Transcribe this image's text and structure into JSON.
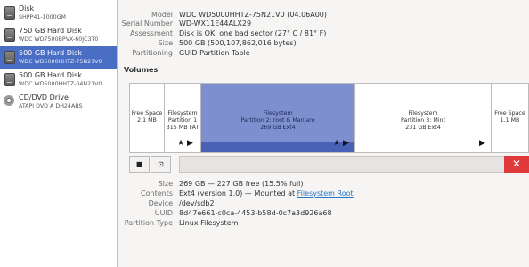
{
  "disks": [
    {
      "name": "Disk",
      "sub": "SHPP41-1000GM",
      "icon": "hard-disk-icon",
      "selected": false
    },
    {
      "name": "750 GB Hard Disk",
      "sub": "WDC WD7500BPVX-60JC3T0",
      "icon": "hard-disk-icon",
      "selected": false
    },
    {
      "name": "500 GB Hard Disk",
      "sub": "WDC WD5000HHTZ-75N21V0",
      "icon": "hard-disk-icon",
      "selected": true
    },
    {
      "name": "500 GB Hard Disk",
      "sub": "WDC WD5000HHTZ-04N21V0",
      "icon": "hard-disk-icon",
      "selected": false
    },
    {
      "name": "CD/DVD Drive",
      "sub": "ATAPI  DVD A  DH24ABS",
      "icon": "optical-disc-icon",
      "selected": false
    }
  ],
  "drive_info": {
    "model_label": "Model",
    "model": "WDC WD5000HHTZ-75N21V0 (04.06A00)",
    "serial_label": "Serial Number",
    "serial": "WD-WX11E44ALX29",
    "assessment_label": "Assessment",
    "assessment": "Disk is OK, one bad sector (27° C / 81° F)",
    "size_label": "Size",
    "size": "500 GB (500,107,862,016 bytes)",
    "partitioning_label": "Partitioning",
    "partitioning": "GUID Partition Table"
  },
  "volumes": {
    "title": "Volumes",
    "segments": [
      {
        "line1": "Free Space",
        "line2": "2.1 MB",
        "line3": ""
      },
      {
        "line1": "Filesystem",
        "line2": "Partition 1",
        "line3": "315 MB FAT"
      },
      {
        "line1": "Filesystem",
        "line2": "Partition 2: root & Manjaro",
        "line3": "269 GB Ext4"
      },
      {
        "line1": "Filesystem",
        "line2": "Partition 3: Mint",
        "line3": "231 GB Ext4"
      },
      {
        "line1": "Free Space",
        "line2": "1.1 MB",
        "line3": ""
      }
    ]
  },
  "details": {
    "size_label": "Size",
    "size": "269 GB — 227 GB free (15.5% full)",
    "contents_label": "Contents",
    "contents_prefix": "Ext4 (version 1.0) — Mounted at ",
    "contents_link": "Filesystem Root",
    "device_label": "Device",
    "device": "/dev/sdb2",
    "uuid_label": "UUID",
    "uuid": "8d47e661-c0ca-4453-b58d-0c7a3d926a68",
    "ptype_label": "Partition Type",
    "ptype": "Linux Filesystem"
  },
  "colors": {
    "selection": "#4a6ec3",
    "selected_partition": "#7e8fd0",
    "delete": "#e0393a",
    "link": "#2a76c6"
  }
}
